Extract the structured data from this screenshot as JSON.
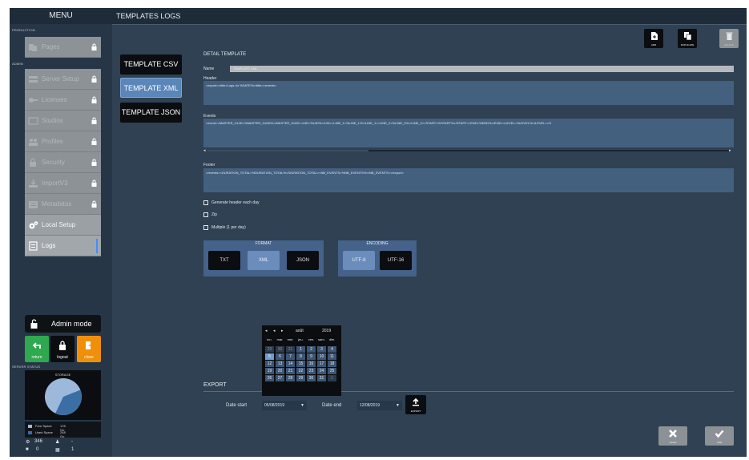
{
  "sidebar": {
    "title": "MENU",
    "section_production": "PRODUCTION",
    "section_admin": "ADMIN",
    "items": [
      {
        "label": "Pages",
        "icon": "pages-icon"
      },
      {
        "label": "Server Setup",
        "icon": "server-icon"
      },
      {
        "label": "Licenses",
        "icon": "key-icon"
      },
      {
        "label": "Studios",
        "icon": "studio-icon"
      },
      {
        "label": "Profiles",
        "icon": "profiles-icon"
      },
      {
        "label": "Security",
        "icon": "security-icon"
      },
      {
        "label": "ImportV3",
        "icon": "import-icon"
      },
      {
        "label": "Metadatas",
        "icon": "metadatas-icon"
      },
      {
        "label": "Local Setup",
        "icon": "gears-icon"
      },
      {
        "label": "Logs",
        "icon": "logs-icon"
      }
    ],
    "admin_mode_label": "Admin mode",
    "tiles": {
      "return": "return",
      "logout": "logout",
      "close": "close"
    },
    "server_status_label": "SERVER STATUS",
    "storage_title": "STORAGE",
    "storage_used_fraction": 0.38,
    "legend": [
      {
        "label": "Free Space",
        "value": "178 Go",
        "color": "#9cb8db"
      },
      {
        "label": "Used Space",
        "value": "248 Go",
        "color": "#3a6ea5"
      }
    ],
    "counters": {
      "a": "346",
      "b": "-",
      "c": "0",
      "d": "1"
    }
  },
  "main": {
    "title": "TEMPLATES LOGS",
    "toolbar": {
      "add": "ADD",
      "duplicate": "DUPLICATE",
      "delete": "DELETE"
    },
    "templates": [
      "TEMPLATE CSV",
      "TEMPLATE XML",
      "TEMPLATE JSON"
    ],
    "detail_title": "DETAIL TEMPLATE",
    "name_label": "Name",
    "name_value": "TEMPLATE XML",
    "header_label": "Header",
    "header_value": "<export><title>Logs du %DATE%</title><events>",
    "events_label": "Events",
    "events_value": "<event><MASTER_GUID>%MASTER_GUID%</MASTER_GUID><UID>%UID%</UID><LINE_1>%LINE_1%</LINE_1><LINE_2>%LINE_2%</LINE_2><START>%START%</START><END>%END%</END><LEVEL>%LEVEL%</LEVEL><H",
    "footer_label": "Footer",
    "footer_value": "</events><DURATION_TOTAL>%DURATION_TOTAL%</DURATION_TOTAL><NB_EVENTS>%NB_EVENTS%</NB_EVENTS></export>",
    "options": [
      "Generate header each day",
      "Zip",
      "Multiple (1 per day)"
    ],
    "format_title": "FORMAT",
    "formats": [
      "TXT",
      "XML",
      "JSON"
    ],
    "encoding_title": "ENCODING",
    "encodings": [
      "UTF-8",
      "UTF-16"
    ],
    "export_title": "EXPORT",
    "date_start_label": "Date start",
    "date_start_value": "05/08/2019",
    "date_end_label": "Date end",
    "date_end_value": "12/08/2019",
    "export_btn": "EXPORT",
    "cancel_btn": "cancel",
    "valid_btn": "valid"
  },
  "calendar": {
    "month": "août",
    "year": "2019",
    "weekdays": [
      "lun.",
      "mar.",
      "mer.",
      "jeu.",
      "ven.",
      "sam.",
      "dim."
    ],
    "rows": [
      [
        "29",
        "30",
        "31",
        "1",
        "2",
        "3",
        "4"
      ],
      [
        "5",
        "6",
        "7",
        "8",
        "9",
        "10",
        "11"
      ],
      [
        "12",
        "13",
        "14",
        "15",
        "16",
        "17",
        "18"
      ],
      [
        "19",
        "20",
        "21",
        "22",
        "23",
        "24",
        "25"
      ],
      [
        "26",
        "27",
        "28",
        "29",
        "30",
        "31",
        "1"
      ]
    ]
  },
  "colors": {
    "accent": "#5a86ba",
    "orange": "#f0900a",
    "green": "#2fa84f"
  }
}
